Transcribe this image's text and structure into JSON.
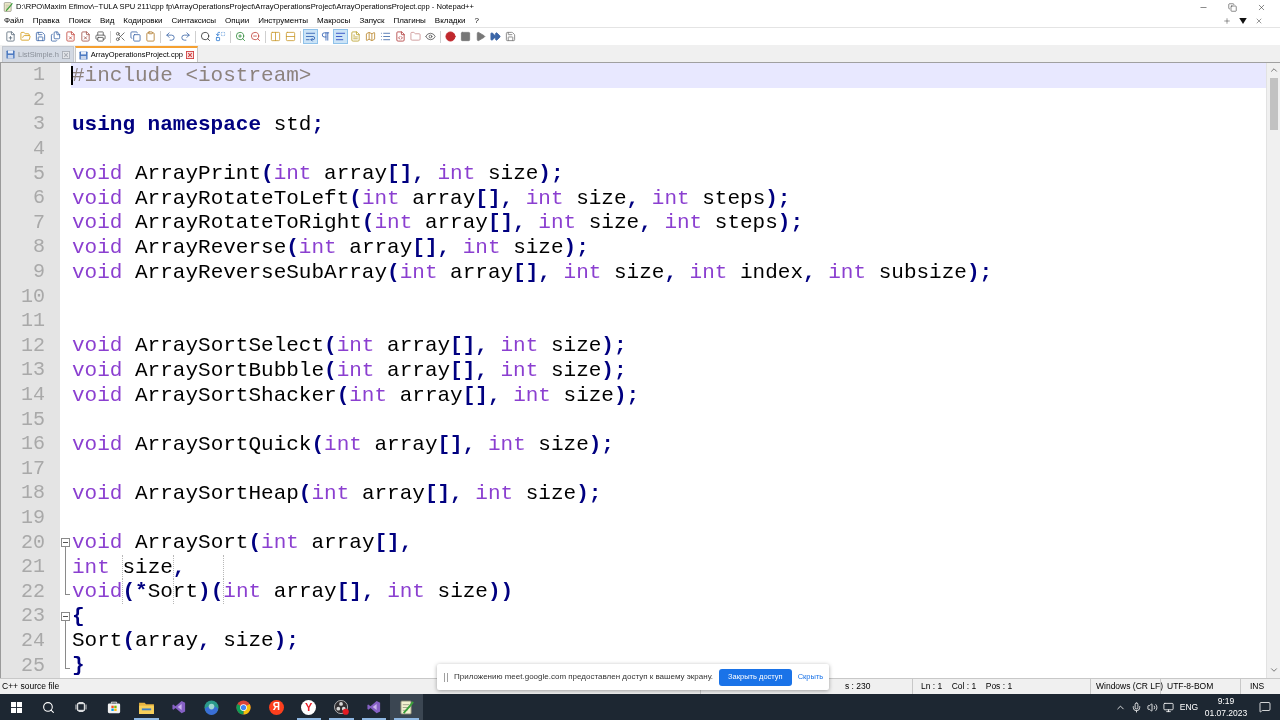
{
  "window": {
    "title": "D:\\RPO\\Maxim Efimov\\~TULA SPU 211\\cpp fp\\ArrayOperationsProject\\ArrayOperationsProject\\ArrayOperationsProject.cpp - Notepad++"
  },
  "menu": [
    "Файл",
    "Правка",
    "Поиск",
    "Вид",
    "Кодировки",
    "Синтаксисы",
    "Опции",
    "Инструменты",
    "Макросы",
    "Запуск",
    "Плагины",
    "Вкладки",
    "?"
  ],
  "toolbar": [
    [
      {
        "kind": "new",
        "pressed": false
      },
      {
        "kind": "open",
        "pressed": false
      },
      {
        "kind": "save",
        "pressed": false
      },
      {
        "kind": "save-all",
        "pressed": false
      },
      {
        "kind": "close",
        "pressed": false
      },
      {
        "kind": "close-all",
        "pressed": false
      },
      {
        "kind": "print",
        "pressed": false
      }
    ],
    [
      {
        "kind": "cut",
        "pressed": false
      },
      {
        "kind": "copy",
        "pressed": false
      },
      {
        "kind": "paste",
        "pressed": false
      }
    ],
    [
      {
        "kind": "undo",
        "pressed": false
      },
      {
        "kind": "redo",
        "pressed": false
      }
    ],
    [
      {
        "kind": "find",
        "pressed": false
      },
      {
        "kind": "replace",
        "pressed": false
      }
    ],
    [
      {
        "kind": "zoom-in",
        "pressed": false
      },
      {
        "kind": "zoom-out",
        "pressed": false
      }
    ],
    [
      {
        "kind": "sync-vertical",
        "pressed": false
      },
      {
        "kind": "sync-horizontal",
        "pressed": false
      }
    ],
    [
      {
        "kind": "word-wrap",
        "pressed": true
      },
      {
        "kind": "all-chars",
        "pressed": false
      },
      {
        "kind": "indent-guide",
        "pressed": true
      },
      {
        "kind": "user-language",
        "pressed": false
      },
      {
        "kind": "document-map",
        "pressed": false
      },
      {
        "kind": "document-list",
        "pressed": false
      },
      {
        "kind": "function-list",
        "pressed": false
      },
      {
        "kind": "folder-workspace",
        "pressed": false
      },
      {
        "kind": "monitoring",
        "pressed": false
      }
    ],
    [
      {
        "kind": "record",
        "pressed": false
      },
      {
        "kind": "stop",
        "pressed": false
      },
      {
        "kind": "play",
        "pressed": false
      },
      {
        "kind": "play-multiple",
        "pressed": false
      },
      {
        "kind": "save-macro",
        "pressed": false
      }
    ]
  ],
  "tabs": [
    {
      "label": "ListSimple.h",
      "selected": false
    },
    {
      "label": "ArrayOperationsProject.cpp",
      "selected": true
    }
  ],
  "editor": {
    "lines": [
      {
        "number": "1",
        "current": true,
        "tokens": [
          {
            "kind": "preprocessor",
            "text": "#include <iostream>"
          }
        ]
      },
      {
        "number": "2",
        "current": false
      },
      {
        "number": "3",
        "current": false,
        "tokens": [
          {
            "kind": "keyword",
            "text": "using namespace "
          },
          {
            "kind": "plain",
            "text": "std"
          },
          {
            "kind": "op",
            "text": ";"
          }
        ]
      },
      {
        "number": "4",
        "current": false
      },
      {
        "number": "5",
        "current": false,
        "tokens": [
          {
            "kind": "type",
            "text": "void "
          },
          {
            "kind": "plain",
            "text": "ArrayPrint"
          },
          {
            "kind": "op",
            "text": "("
          },
          {
            "kind": "type",
            "text": "int "
          },
          {
            "kind": "plain",
            "text": "array"
          },
          {
            "kind": "op",
            "text": "[], "
          },
          {
            "kind": "type",
            "text": "int "
          },
          {
            "kind": "plain",
            "text": "size"
          },
          {
            "kind": "op",
            "text": ");"
          }
        ]
      },
      {
        "number": "6",
        "current": false,
        "tokens": [
          {
            "kind": "type",
            "text": "void "
          },
          {
            "kind": "plain",
            "text": "ArrayRotateToLeft"
          },
          {
            "kind": "op",
            "text": "("
          },
          {
            "kind": "type",
            "text": "int "
          },
          {
            "kind": "plain",
            "text": "array"
          },
          {
            "kind": "op",
            "text": "[], "
          },
          {
            "kind": "type",
            "text": "int "
          },
          {
            "kind": "plain",
            "text": "size"
          },
          {
            "kind": "op",
            "text": ", "
          },
          {
            "kind": "type",
            "text": "int "
          },
          {
            "kind": "plain",
            "text": "steps"
          },
          {
            "kind": "op",
            "text": ");"
          }
        ]
      },
      {
        "number": "7",
        "current": false,
        "tokens": [
          {
            "kind": "type",
            "text": "void "
          },
          {
            "kind": "plain",
            "text": "ArrayRotateToRight"
          },
          {
            "kind": "op",
            "text": "("
          },
          {
            "kind": "type",
            "text": "int "
          },
          {
            "kind": "plain",
            "text": "array"
          },
          {
            "kind": "op",
            "text": "[], "
          },
          {
            "kind": "type",
            "text": "int "
          },
          {
            "kind": "plain",
            "text": "size"
          },
          {
            "kind": "op",
            "text": ", "
          },
          {
            "kind": "type",
            "text": "int "
          },
          {
            "kind": "plain",
            "text": "steps"
          },
          {
            "kind": "op",
            "text": ");"
          }
        ]
      },
      {
        "number": "8",
        "current": false,
        "tokens": [
          {
            "kind": "type",
            "text": "void "
          },
          {
            "kind": "plain",
            "text": "ArrayReverse"
          },
          {
            "kind": "op",
            "text": "("
          },
          {
            "kind": "type",
            "text": "int "
          },
          {
            "kind": "plain",
            "text": "array"
          },
          {
            "kind": "op",
            "text": "[], "
          },
          {
            "kind": "type",
            "text": "int "
          },
          {
            "kind": "plain",
            "text": "size"
          },
          {
            "kind": "op",
            "text": ");"
          }
        ]
      },
      {
        "number": "9",
        "current": false,
        "tokens": [
          {
            "kind": "type",
            "text": "void "
          },
          {
            "kind": "plain",
            "text": "ArrayReverseSubArray"
          },
          {
            "kind": "op",
            "text": "("
          },
          {
            "kind": "type",
            "text": "int "
          },
          {
            "kind": "plain",
            "text": "array"
          },
          {
            "kind": "op",
            "text": "[], "
          },
          {
            "kind": "type",
            "text": "int "
          },
          {
            "kind": "plain",
            "text": "size"
          },
          {
            "kind": "op",
            "text": ", "
          },
          {
            "kind": "type",
            "text": "int "
          },
          {
            "kind": "plain",
            "text": "index"
          },
          {
            "kind": "op",
            "text": ", "
          },
          {
            "kind": "type",
            "text": "int "
          },
          {
            "kind": "plain",
            "text": "subsize"
          },
          {
            "kind": "op",
            "text": ");"
          }
        ]
      },
      {
        "number": "10",
        "current": false
      },
      {
        "number": "11",
        "current": false
      },
      {
        "number": "12",
        "current": false,
        "tokens": [
          {
            "kind": "type",
            "text": "void "
          },
          {
            "kind": "plain",
            "text": "ArraySortSelect"
          },
          {
            "kind": "op",
            "text": "("
          },
          {
            "kind": "type",
            "text": "int "
          },
          {
            "kind": "plain",
            "text": "array"
          },
          {
            "kind": "op",
            "text": "[], "
          },
          {
            "kind": "type",
            "text": "int "
          },
          {
            "kind": "plain",
            "text": "size"
          },
          {
            "kind": "op",
            "text": ");"
          }
        ]
      },
      {
        "number": "13",
        "current": false,
        "tokens": [
          {
            "kind": "type",
            "text": "void "
          },
          {
            "kind": "plain",
            "text": "ArraySortBubble"
          },
          {
            "kind": "op",
            "text": "("
          },
          {
            "kind": "type",
            "text": "int "
          },
          {
            "kind": "plain",
            "text": "array"
          },
          {
            "kind": "op",
            "text": "[], "
          },
          {
            "kind": "type",
            "text": "int "
          },
          {
            "kind": "plain",
            "text": "size"
          },
          {
            "kind": "op",
            "text": ");"
          }
        ]
      },
      {
        "number": "14",
        "current": false,
        "tokens": [
          {
            "kind": "type",
            "text": "void "
          },
          {
            "kind": "plain",
            "text": "ArraySortShacker"
          },
          {
            "kind": "op",
            "text": "("
          },
          {
            "kind": "type",
            "text": "int "
          },
          {
            "kind": "plain",
            "text": "array"
          },
          {
            "kind": "op",
            "text": "[], "
          },
          {
            "kind": "type",
            "text": "int "
          },
          {
            "kind": "plain",
            "text": "size"
          },
          {
            "kind": "op",
            "text": ");"
          }
        ]
      },
      {
        "number": "15",
        "current": false
      },
      {
        "number": "16",
        "current": false,
        "tokens": [
          {
            "kind": "type",
            "text": "void "
          },
          {
            "kind": "plain",
            "text": "ArraySortQuick"
          },
          {
            "kind": "op",
            "text": "("
          },
          {
            "kind": "type",
            "text": "int "
          },
          {
            "kind": "plain",
            "text": "array"
          },
          {
            "kind": "op",
            "text": "[], "
          },
          {
            "kind": "type",
            "text": "int "
          },
          {
            "kind": "plain",
            "text": "size"
          },
          {
            "kind": "op",
            "text": ");"
          }
        ]
      },
      {
        "number": "17",
        "current": false
      },
      {
        "number": "18",
        "current": false,
        "tokens": [
          {
            "kind": "type",
            "text": "void "
          },
          {
            "kind": "plain",
            "text": "ArraySortHeap"
          },
          {
            "kind": "op",
            "text": "("
          },
          {
            "kind": "type",
            "text": "int "
          },
          {
            "kind": "plain",
            "text": "array"
          },
          {
            "kind": "op",
            "text": "[], "
          },
          {
            "kind": "type",
            "text": "int "
          },
          {
            "kind": "plain",
            "text": "size"
          },
          {
            "kind": "op",
            "text": ");"
          }
        ]
      },
      {
        "number": "19",
        "current": false
      },
      {
        "number": "20",
        "current": false,
        "fold": {
          "kind": "start",
          "expanded": true
        },
        "tokens": [
          {
            "kind": "type",
            "text": "void "
          },
          {
            "kind": "plain",
            "text": "ArraySort"
          },
          {
            "kind": "op",
            "text": "("
          },
          {
            "kind": "type",
            "text": "int "
          },
          {
            "kind": "plain",
            "text": "array"
          },
          {
            "kind": "op",
            "text": "[],"
          }
        ]
      },
      {
        "number": "21",
        "current": false,
        "fold": {
          "kind": "line"
        },
        "tokens": [
          {
            "kind": "type",
            "text": "               int "
          },
          {
            "kind": "plain",
            "text": "size"
          },
          {
            "kind": "op",
            "text": ","
          }
        ]
      },
      {
        "number": "22",
        "current": false,
        "fold": {
          "kind": "end"
        },
        "tokens": [
          {
            "kind": "type",
            "text": "               void"
          },
          {
            "kind": "op",
            "text": "(*"
          },
          {
            "kind": "plain",
            "text": "Sort"
          },
          {
            "kind": "op",
            "text": ")("
          },
          {
            "kind": "type",
            "text": "int "
          },
          {
            "kind": "plain",
            "text": "array"
          },
          {
            "kind": "op",
            "text": "[], "
          },
          {
            "kind": "type",
            "text": "int "
          },
          {
            "kind": "plain",
            "text": "size"
          },
          {
            "kind": "op",
            "text": "))"
          }
        ]
      },
      {
        "number": "23",
        "current": false,
        "fold": {
          "kind": "start",
          "expanded": true
        },
        "tokens": [
          {
            "kind": "op",
            "text": "{"
          }
        ]
      },
      {
        "number": "24",
        "current": false,
        "fold": {
          "kind": "line"
        },
        "tokens": [
          {
            "kind": "plain",
            "text": "    Sort"
          },
          {
            "kind": "op",
            "text": "("
          },
          {
            "kind": "plain",
            "text": "array"
          },
          {
            "kind": "op",
            "text": ", "
          },
          {
            "kind": "plain",
            "text": "size"
          },
          {
            "kind": "op",
            "text": ");"
          }
        ]
      },
      {
        "number": "25",
        "current": false,
        "fold": {
          "kind": "end"
        },
        "tokens": [
          {
            "kind": "op",
            "text": "}"
          }
        ]
      }
    ]
  },
  "status_bar": {
    "file_type": "C++ source file",
    "length_lines": "s : 230",
    "position": "Ln : 1    Col : 1    Pos : 1",
    "line_endings": "Windows (CR LF)",
    "encoding": "UTF-8-BOM",
    "mode": "INS"
  },
  "screen_share_notice": {
    "message": "Приложению meet.google.com предоставлен доступ к вашему экрану.",
    "stop_button": "Закрыть доступ",
    "hide_link": "Скрыть"
  },
  "taskbar": {
    "apps": [
      {
        "kind": "bag",
        "running": false,
        "selected": false
      },
      {
        "kind": "folder",
        "running": true,
        "selected": false
      },
      {
        "kind": "ribbon",
        "running": false,
        "selected": false
      },
      {
        "kind": "round",
        "running": false,
        "selected": false
      },
      {
        "kind": "wheel",
        "running": false,
        "selected": false
      },
      {
        "kind": "letter-disc",
        "logo_text": "Я",
        "running": false,
        "selected": false
      },
      {
        "kind": "letter-ring",
        "logo_text": "Y",
        "running": true,
        "selected": false
      },
      {
        "kind": "lens",
        "running": true,
        "selected": false
      },
      {
        "kind": "ribbon",
        "running": true,
        "selected": false
      },
      {
        "kind": "notepad",
        "running": true,
        "selected": true
      }
    ],
    "language": "ENG",
    "time": "9:19",
    "date": "01.07.2023"
  }
}
